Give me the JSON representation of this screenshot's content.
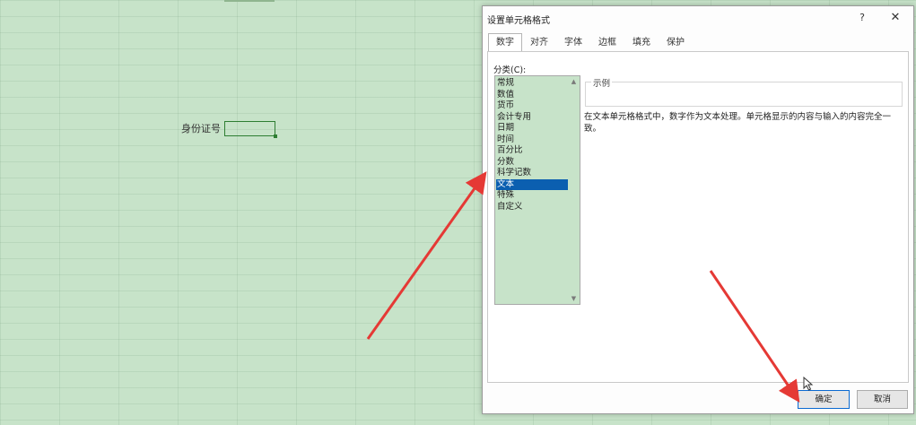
{
  "sheet": {
    "cell_label": "身份证号"
  },
  "dialog": {
    "title": "设置单元格格式",
    "help_label": "?",
    "close_label": "✕",
    "tabs": [
      {
        "label": "数字",
        "active": true
      },
      {
        "label": "对齐",
        "active": false
      },
      {
        "label": "字体",
        "active": false
      },
      {
        "label": "边框",
        "active": false
      },
      {
        "label": "填充",
        "active": false
      },
      {
        "label": "保护",
        "active": false
      }
    ],
    "category_label": "分类(C):",
    "categories": [
      "常规",
      "数值",
      "货币",
      "会计专用",
      "日期",
      "时间",
      "百分比",
      "分数",
      "科学记数",
      "文本",
      "特殊",
      "自定义"
    ],
    "selected_category": "文本",
    "sample_legend": "示例",
    "description": "在文本单元格格式中，数字作为文本处理。单元格显示的内容与输入的内容完全一致。",
    "ok_label": "确定",
    "cancel_label": "取消"
  },
  "annotation_arrows": {
    "color": "#e53935",
    "count": 2
  }
}
